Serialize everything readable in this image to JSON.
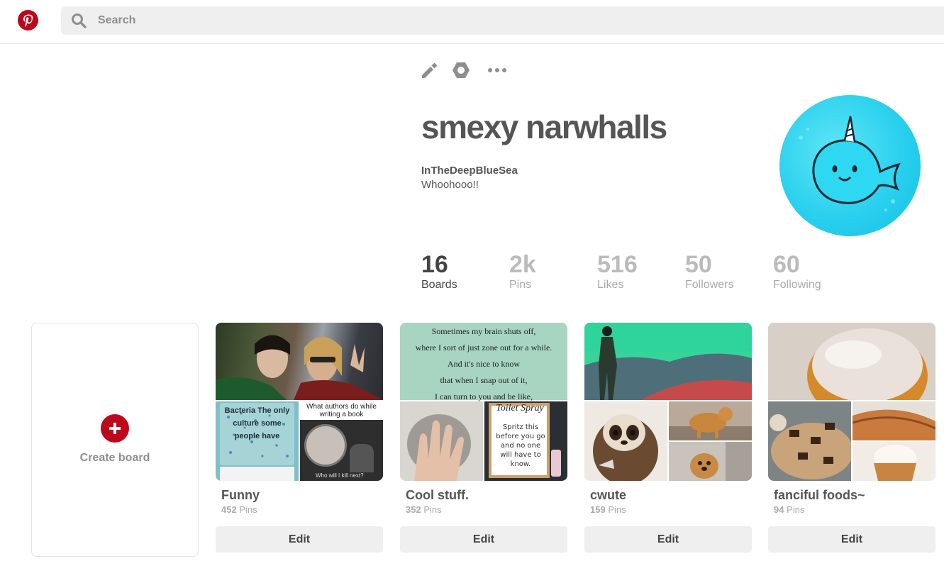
{
  "header": {
    "search_placeholder": "Search"
  },
  "profile": {
    "name": "smexy narwhalls",
    "username": "InTheDeepBlueSea",
    "bio": "Whoohooo!!"
  },
  "stats": [
    {
      "value": "16",
      "label": "Boards"
    },
    {
      "value": "2k",
      "label": "Pins"
    },
    {
      "value": "516",
      "label": "Likes"
    },
    {
      "value": "50",
      "label": "Followers"
    },
    {
      "value": "60",
      "label": "Following"
    }
  ],
  "create_board_label": "Create board",
  "boards": [
    {
      "title": "Funny",
      "pin_count": "452",
      "pins_label": "Pins",
      "edit_label": "Edit",
      "cover_text": {
        "bottom_left": "Bacteria The only culture some people have",
        "bottom_right": "What authors do while writing a book",
        "bottom_right_caption": "Who will I kill next?"
      }
    },
    {
      "title": "Cool stuff.",
      "pin_count": "352",
      "pins_label": "Pins",
      "edit_label": "Edit",
      "cover_text": {
        "main": [
          "Sometimes my brain shuts off,",
          "where I sort of just zone out for a while.",
          "And it's nice to know",
          "that when I snap out of it,",
          "I can turn to you and be like,"
        ],
        "bottom_right_title": "Toilet Spray",
        "bottom_right": "Spritz this before you go and no one will have to know."
      }
    },
    {
      "title": "cwute",
      "pin_count": "159",
      "pins_label": "Pins",
      "edit_label": "Edit"
    },
    {
      "title": "fanciful foods~",
      "pin_count": "94",
      "pins_label": "Pins",
      "edit_label": "Edit"
    }
  ],
  "colors": {
    "brand": "#bd081c",
    "avatar": "#2ad0ee"
  }
}
